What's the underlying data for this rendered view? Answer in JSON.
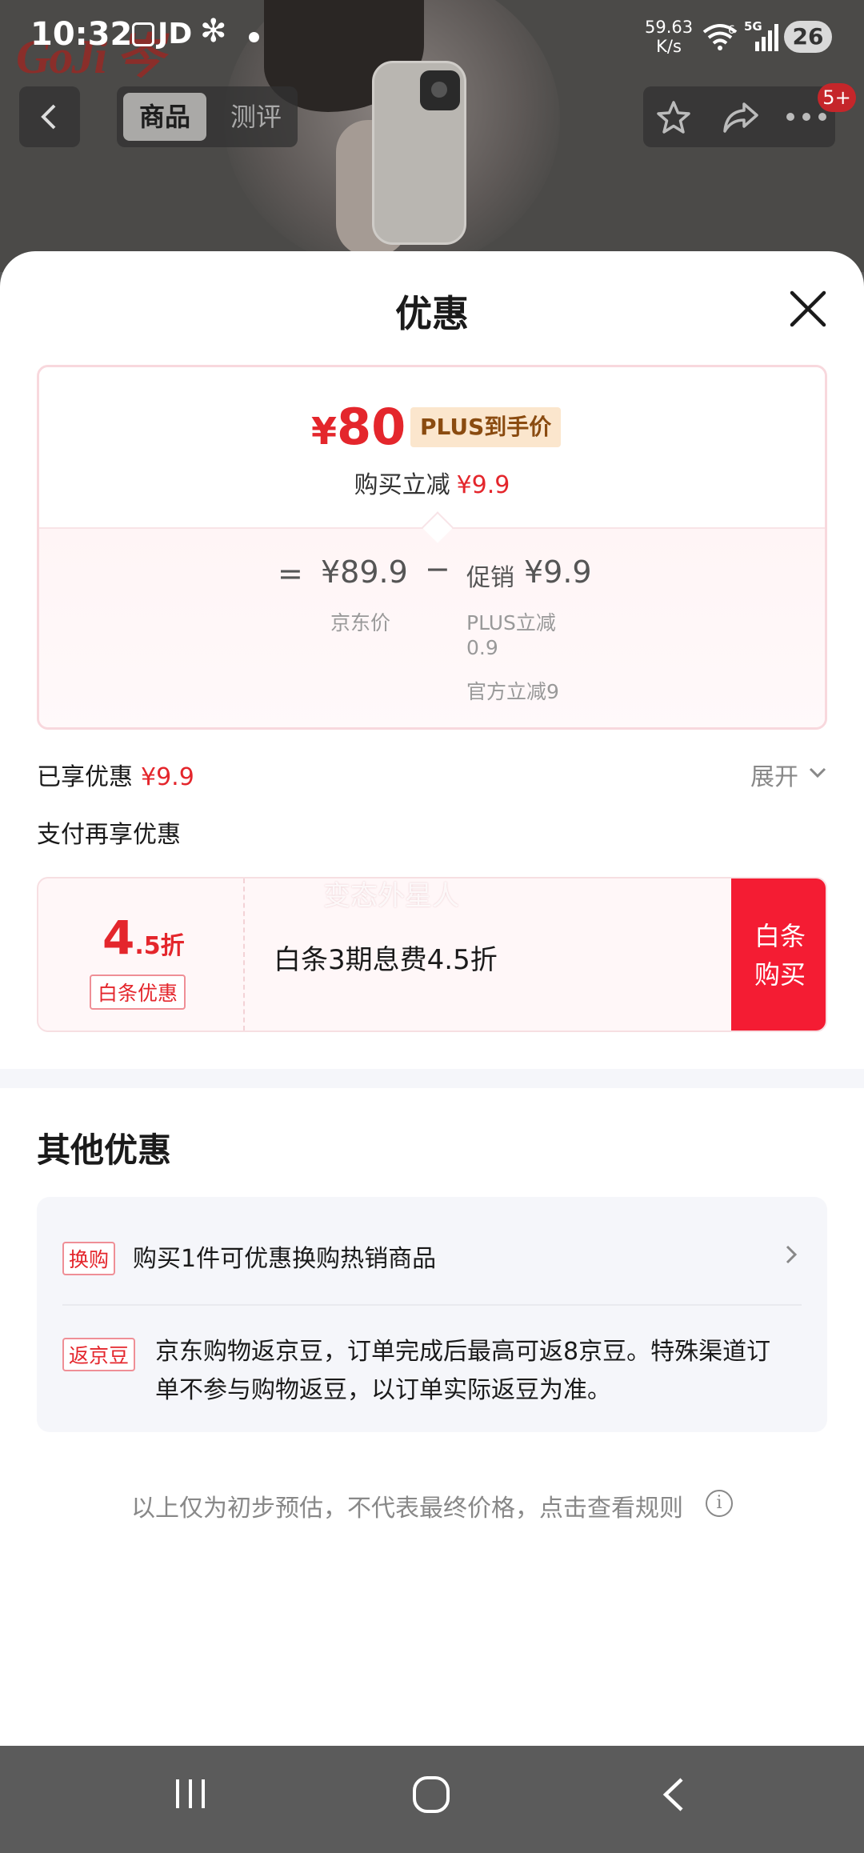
{
  "status_bar": {
    "time": "10:32",
    "app_label": "JD",
    "net_speed_value": "59.63",
    "net_speed_unit": "K/s",
    "wifi_label": "6",
    "signal_label": "5G",
    "battery": "26"
  },
  "background": {
    "logo_text": "GoJi 岑",
    "tab_goods": "商品",
    "tab_review": "测评",
    "badge": "5+"
  },
  "sheet": {
    "title": "优惠",
    "price_card": {
      "currency": "¥",
      "final_price": "80",
      "plus_tag": "PLUS到手价",
      "instant_label": "购买立减",
      "instant_value": "¥9.9",
      "equals": "=",
      "jd_price": "¥89.9",
      "minus": "−",
      "promo_label": "促销",
      "promo_value": "¥9.9",
      "jd_price_label": "京东价",
      "plus_discount_label": "PLUS立减",
      "plus_discount_value": "0.9",
      "official_discount": "官方立减9"
    },
    "enjoyed_label": "已享优惠",
    "enjoyed_value": "¥9.9",
    "expand_label": "展开",
    "pay_more_label": "支付再享优惠",
    "baitiao": {
      "discount_int": "4",
      "discount_suffix": ".5折",
      "tag": "白条优惠",
      "description": "白条3期息费4.5折",
      "watermark": "变态外星人",
      "button_line1": "白条",
      "button_line2": "购买"
    },
    "other_title": "其他优惠",
    "other_items": [
      {
        "tag": "换购",
        "text": "购买1件可优惠换购热销商品"
      },
      {
        "tag": "返京豆",
        "text": "京东购物返京豆，订单完成后最高可返8京豆。特殊渠道订单不参与购物返豆，以订单实际返豆为准。"
      }
    ],
    "disclaimer": "以上仅为初步预估，不代表最终价格，点击查看规则",
    "info_icon": "i"
  },
  "colors": {
    "accent_red": "#e4262c",
    "button_red": "#f41c33",
    "plus_tag_bg": "#fbe6cd"
  }
}
